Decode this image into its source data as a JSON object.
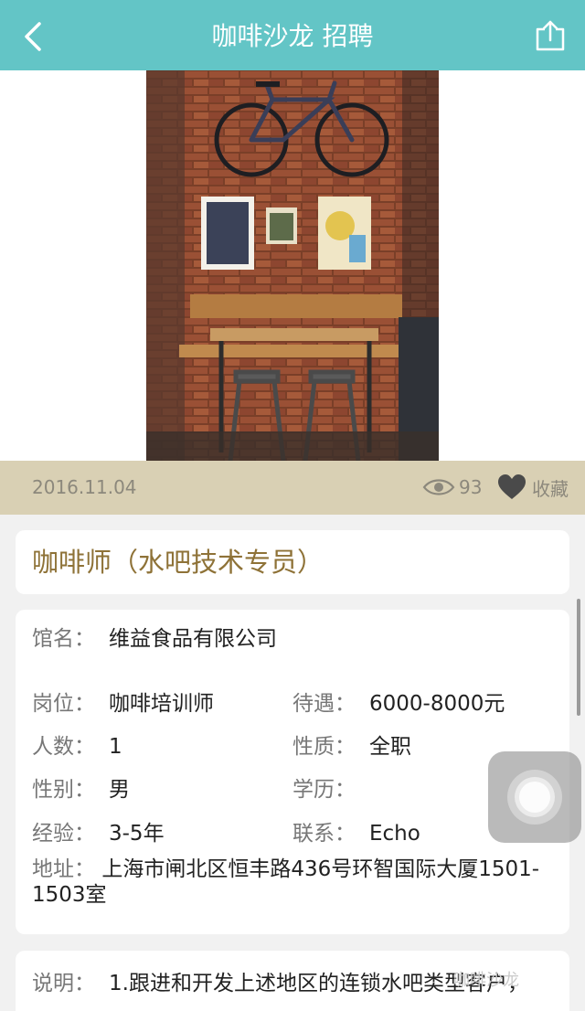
{
  "navbar": {
    "title": "咖啡沙龙 招聘",
    "back_icon": "chevron-left-icon",
    "share_icon": "share-icon",
    "bg_color": "#63c5c6"
  },
  "post": {
    "date": "2016.11.04",
    "views": "93",
    "favorite_label": "收藏"
  },
  "job": {
    "title": "咖啡师（水吧技术专员）"
  },
  "details": {
    "company_label": "馆名：",
    "company_value": "维益食品有限公司",
    "position_label": "岗位：",
    "position_value": "咖啡培训师",
    "salary_label": "待遇：",
    "salary_value": "6000-8000元",
    "headcount_label": "人数：",
    "headcount_value": "1",
    "type_label": "性质：",
    "type_value": "全职",
    "gender_label": "性别：",
    "gender_value": "男",
    "education_label": "学历：",
    "education_value": "",
    "experience_label": "经验：",
    "experience_value": "3-5年",
    "contact_label": "联系：",
    "contact_value": "Echo",
    "address_label": "地址：",
    "address_value": "上海市闸北区恒丰路436号环智国际大厦1501-1503室"
  },
  "description": {
    "label": "说明：",
    "text": "1.跟进和开发上述地区的连锁水吧类型客户，"
  },
  "watermark": "咖啡沙龙"
}
